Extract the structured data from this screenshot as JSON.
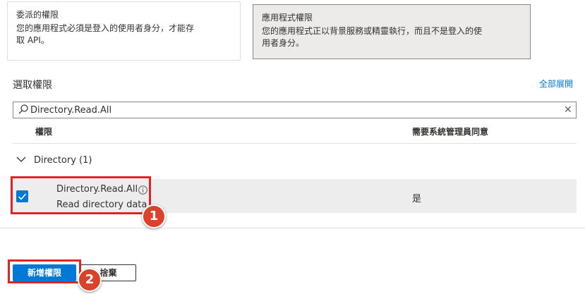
{
  "permission_types": {
    "delegated": {
      "title": "委派的權限",
      "description_line1": "您的應用程式必須是登入的使用者身分，才能存",
      "description_line2": "取 API。"
    },
    "application": {
      "title": "應用程式權限",
      "description_line1": "您的應用程式正以背景服務或精靈執行，而且不是登入的使",
      "description_line2": "用者身分。"
    }
  },
  "select_permissions": {
    "title": "選取權限",
    "expand_all": "全部展開"
  },
  "search": {
    "value": "Directory.Read.All",
    "clear_icon": "close-icon"
  },
  "table": {
    "columns": [
      "權限",
      "需要系統管理員同意"
    ]
  },
  "group": {
    "label": "Directory (1)",
    "expanded": true
  },
  "permission": {
    "name": "Directory.Read.All",
    "description": "Read directory data",
    "admin_consent": "是",
    "checked": true
  },
  "buttons": {
    "add": "新增權限",
    "discard": "捨棄"
  },
  "annotations": {
    "step1": "1",
    "step2": "2"
  },
  "colors": {
    "accent": "#0078d4",
    "annotation_red": "#e02424",
    "badge": "#d9432b"
  }
}
